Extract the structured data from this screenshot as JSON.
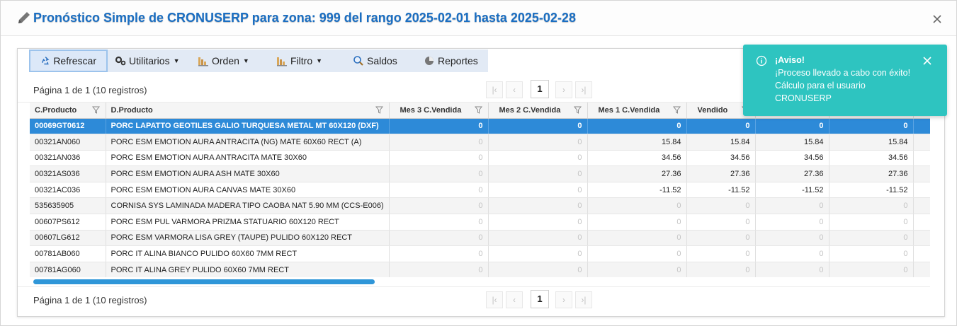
{
  "dialog": {
    "title": "Pronóstico Simple de CRONUSERP para zona: 999 del rango 2025-02-01 hasta 2025-02-28",
    "icons": {
      "title": "pencil-icon",
      "close": "close-icon"
    }
  },
  "toolbar": {
    "refresh": {
      "label": "Refrescar",
      "icon": "recycle-icon"
    },
    "utilities": {
      "label": "Utilitarios",
      "icon": "gears-icon"
    },
    "order": {
      "label": "Orden",
      "icon": "sort-icon"
    },
    "filter": {
      "label": "Filtro",
      "icon": "filter-bars-icon"
    },
    "balances": {
      "label": "Saldos",
      "icon": "magnifier-icon"
    },
    "reports": {
      "label": "Reportes",
      "icon": "chart-pie-icon"
    }
  },
  "pager": {
    "info": "Página 1 de 1 (10 registros)",
    "current_page": "1",
    "buttons": {
      "first": "|‹",
      "prev": "‹",
      "next": "›",
      "last": "›|"
    }
  },
  "table": {
    "columns": [
      "C.Producto",
      "D.Producto",
      "Mes 3 C.Vendida",
      "Mes 2 C.Vendida",
      "Mes 1 C.Vendida",
      "Vendido",
      "",
      ""
    ],
    "rows": [
      [
        "00069GT0612",
        "PORC LAPATTO GEOTILES GALIO TURQUESA METAL MT 60X120 (DXF)",
        "0",
        "0",
        "0",
        "0",
        "0",
        "0"
      ],
      [
        "00321AN060",
        "PORC ESM EMOTION AURA ANTRACITA (NG) MATE 60X60 RECT (A)",
        "0",
        "0",
        "15.84",
        "15.84",
        "15.84",
        "15.84"
      ],
      [
        "00321AN036",
        "PORC ESM EMOTION AURA ANTRACITA MATE 30X60",
        "0",
        "0",
        "34.56",
        "34.56",
        "34.56",
        "34.56"
      ],
      [
        "00321AS036",
        "PORC ESM EMOTION AURA ASH MATE 30X60",
        "0",
        "0",
        "27.36",
        "27.36",
        "27.36",
        "27.36"
      ],
      [
        "00321AC036",
        "PORC ESM EMOTION AURA CANVAS MATE 30X60",
        "0",
        "0",
        "-11.52",
        "-11.52",
        "-11.52",
        "-11.52"
      ],
      [
        "535635905",
        "CORNISA SYS LAMINADA MADERA TIPO CAOBA NAT 5.90 MM (CCS-E006)",
        "0",
        "0",
        "0",
        "0",
        "0",
        "0"
      ],
      [
        "00607PS612",
        "PORC ESM PUL VARMORA PRIZMA STATUARIO 60X120 RECT",
        "0",
        "0",
        "0",
        "0",
        "0",
        "0"
      ],
      [
        "00607LG612",
        "PORC ESM VARMORA LISA GREY (TAUPE) PULIDO 60X120 RECT",
        "0",
        "0",
        "0",
        "0",
        "0",
        "0"
      ],
      [
        "00781AB060",
        "PORC IT ALINA BIANCO PULIDO 60X60 7MM RECT",
        "0",
        "0",
        "0",
        "0",
        "0",
        "0"
      ],
      [
        "00781AG060",
        "PORC IT ALINA GREY PULIDO 60X60 7MM RECT",
        "0",
        "0",
        "0",
        "0",
        "0",
        "0"
      ]
    ],
    "selected_row": 0
  },
  "toast": {
    "title": "¡Aviso!",
    "lines": [
      "¡Proceso llevado a cabo con éxito!",
      "Cálculo para el usuario",
      "CRONUSERP"
    ],
    "icons": {
      "info": "info-circle-icon",
      "close": "close-icon"
    }
  },
  "colors": {
    "title": "#1a6ec2",
    "selected_row": "#2d8ad8",
    "toast": "#2ec4c0",
    "toolbar": "#e2eaf5",
    "scrollbar": "#2f96d8"
  }
}
